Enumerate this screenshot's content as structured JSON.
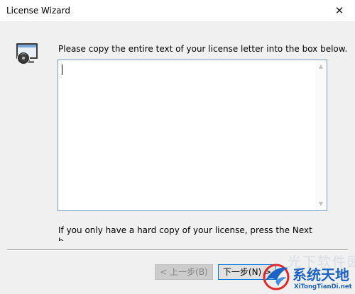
{
  "window": {
    "title": "License Wizard",
    "close_glyph": "✕"
  },
  "content": {
    "instruction": "Please copy the entire text of your license letter into the box below.",
    "license_text_value": "",
    "hint": "If you only have a hard copy of your license, press the Next",
    "hint_cut": "b"
  },
  "buttons": {
    "back_label": "< 上一步(B)",
    "next_label": "下一步(N) >"
  },
  "watermark": {
    "background_text": "光下软件园",
    "logo_title": "系统天地",
    "logo_url": "XiTongTianDi.net"
  },
  "icons": {
    "wizard": "computer-disc-icon",
    "scroll_up": "chevron-up-icon",
    "scroll_down": "chevron-down-icon"
  },
  "colors": {
    "textarea_border": "#7a9cc8",
    "next_button_border": "#0078d7",
    "logo_blue": "#1d63c4"
  }
}
